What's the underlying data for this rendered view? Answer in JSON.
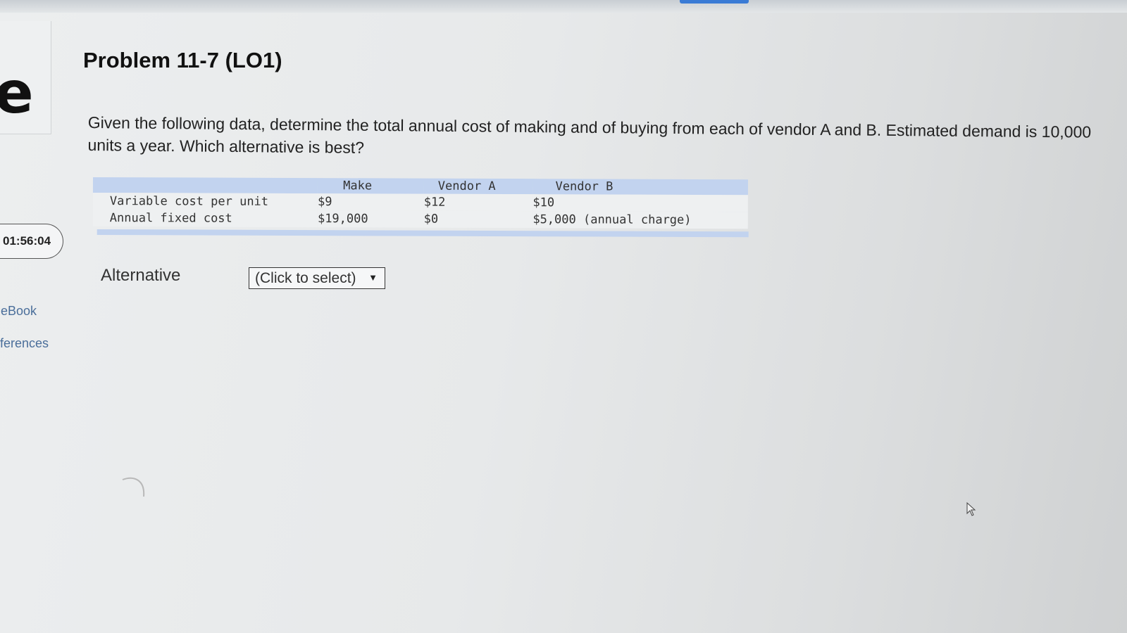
{
  "sidebar": {
    "timer": "01:56:04",
    "links": [
      {
        "label": "eBook"
      },
      {
        "label": "eferences"
      }
    ]
  },
  "problem": {
    "title": "Problem 11-7 (LO1)",
    "question": "Given the following data, determine the total annual cost of making and of buying from each of vendor A and B. Estimated demand is 10,000 units a year. Which alternative is best?"
  },
  "table": {
    "headers": [
      "",
      "Make",
      "Vendor A",
      "Vendor B"
    ],
    "rows": [
      [
        "Variable cost per unit",
        "$9",
        "$12",
        "$10"
      ],
      [
        "Annual fixed cost",
        "$19,000",
        "$0",
        "$5,000 (annual charge)"
      ]
    ]
  },
  "answer": {
    "label": "Alternative",
    "select_value": "(Click to select)",
    "select_arrow": "▼"
  },
  "colors": {
    "table_header": "#c2d3ef",
    "link": "#4a6e9a",
    "topbar_accent": "#3a7bd5"
  }
}
